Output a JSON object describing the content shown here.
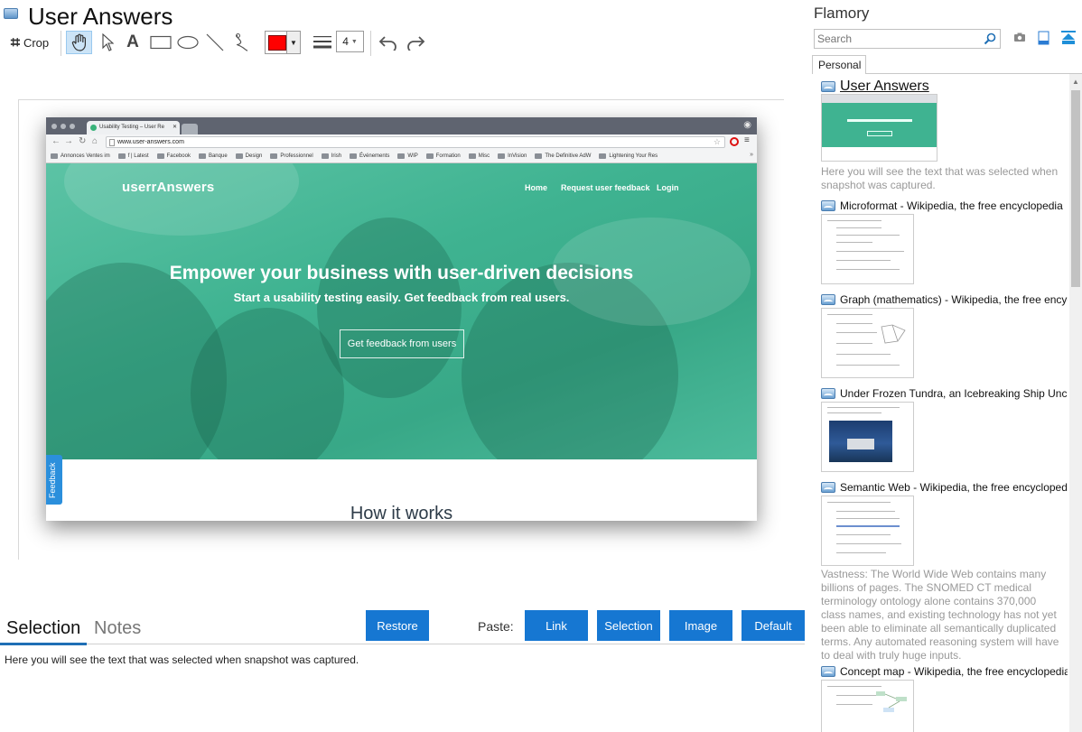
{
  "window": {
    "title": "User Answers"
  },
  "toolbar": {
    "crop_label": "Crop",
    "stroke_width": "4",
    "colors": {
      "stroke": "#ff0000",
      "active_tool_bg": "#cce4f7"
    }
  },
  "screenshot": {
    "tab_title": "Usability Testing – User Re",
    "url": "www.user-answers.com",
    "bookmarks": [
      "Annonces Ventes im",
      "f | Latest",
      "Facebook",
      "Banque",
      "Design",
      "Professionnel",
      "Irish",
      "Événements",
      "WIP",
      "Formation",
      "Misc",
      "InVision",
      "The Definitive AdW",
      "Lightening Your Res"
    ],
    "bookmarks_more": "»",
    "logo": "userrAnswers",
    "nav": [
      "Home",
      "Request user feedback",
      "Login"
    ],
    "headline": "Empower your business with user-driven decisions",
    "subheadline": "Start a usability testing easily. Get feedback from real users.",
    "cta": "Get feedback from users",
    "section_heading": "How it works",
    "feedback_tab": "Feedback"
  },
  "bottom": {
    "tab_selection": "Selection",
    "tab_notes": "Notes",
    "restore_label": "Restore",
    "paste_label": "Paste:",
    "paste_buttons": [
      "Link",
      "Selection",
      "Image",
      "Default"
    ],
    "selection_text": "Here you will see the text that was selected when snapshot was captured.",
    "colors": {
      "button": "#1677d2"
    }
  },
  "sidebar": {
    "title": "Flamory",
    "search_placeholder": "Search",
    "tab_personal": "Personal",
    "items": [
      {
        "title": "User Answers",
        "snippet": "Here you will see the text that was selected when snapshot was captured."
      },
      {
        "title": "Microformat - Wikipedia, the free encyclopedia"
      },
      {
        "title": "Graph (mathematics) - Wikipedia, the free encyclopedia"
      },
      {
        "title": "Under Frozen Tundra, an Icebreaking Ship Uncovers"
      },
      {
        "title": "Semantic Web - Wikipedia, the free encyclopedia",
        "snippet": "Vastness: The World Wide Web contains many billions of pages. The SNOMED CT medical terminology ontology alone contains 370,000 class names, and existing technology has not yet been able to eliminate all semantically duplicated terms. Any automated reasoning system will have to deal with truly huge inputs."
      },
      {
        "title": "Concept map - Wikipedia, the free encyclopedia"
      }
    ]
  }
}
